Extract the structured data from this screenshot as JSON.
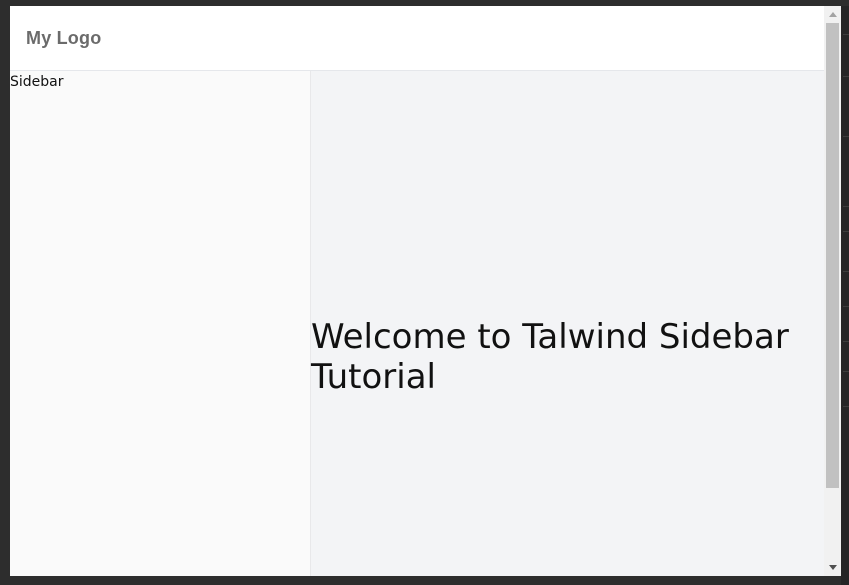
{
  "header": {
    "logo_text": "My Logo"
  },
  "sidebar": {
    "label": "Sidebar"
  },
  "main": {
    "welcome_text": "Welcome to Talwind Sidebar Tutorial"
  },
  "scrollbar": {
    "up_icon": "chevron-up-icon",
    "down_icon": "chevron-down-icon"
  },
  "colors": {
    "sidebar_bg": "#fafafa",
    "main_bg": "#f3f4f6",
    "header_bg": "#ffffff",
    "logo_color": "#6b6b6b"
  }
}
